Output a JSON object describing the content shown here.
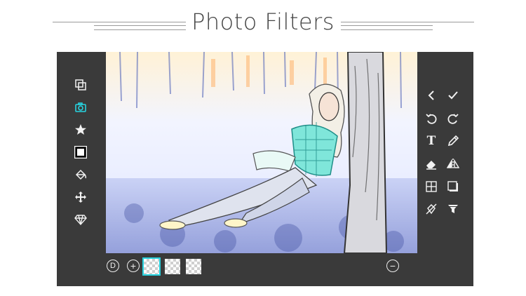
{
  "header": {
    "title": "Photo Filters"
  },
  "left_toolbar": [
    {
      "icon": "layers-icon"
    },
    {
      "icon": "camera-icon",
      "active": true
    },
    {
      "icon": "star-icon"
    },
    {
      "icon": "color-swatch-icon"
    },
    {
      "icon": "paint-bucket-icon"
    },
    {
      "icon": "move-icon"
    },
    {
      "icon": "diamond-icon"
    }
  ],
  "right_toolbar": [
    {
      "icon": "back-chevron-icon"
    },
    {
      "icon": "checkmark-icon"
    },
    {
      "icon": "undo-icon"
    },
    {
      "icon": "redo-icon"
    },
    {
      "icon": "text-icon",
      "label": "T"
    },
    {
      "icon": "pencil-icon"
    },
    {
      "icon": "eraser-icon"
    },
    {
      "icon": "flip-icon"
    },
    {
      "icon": "grid-icon"
    },
    {
      "icon": "shadow-square-icon"
    },
    {
      "icon": "no-fill-icon"
    },
    {
      "icon": "filter-funnel-icon"
    }
  ],
  "bottom_bar": {
    "d_button_label": "D",
    "add_button_label": "+",
    "remove_button_label": "−",
    "layers": [
      {
        "selected": true
      },
      {
        "selected": false
      },
      {
        "selected": false
      }
    ]
  },
  "colors": {
    "accent": "#27d3e0",
    "panel": "#3a3a3a",
    "icon": "#f2f2f2"
  }
}
